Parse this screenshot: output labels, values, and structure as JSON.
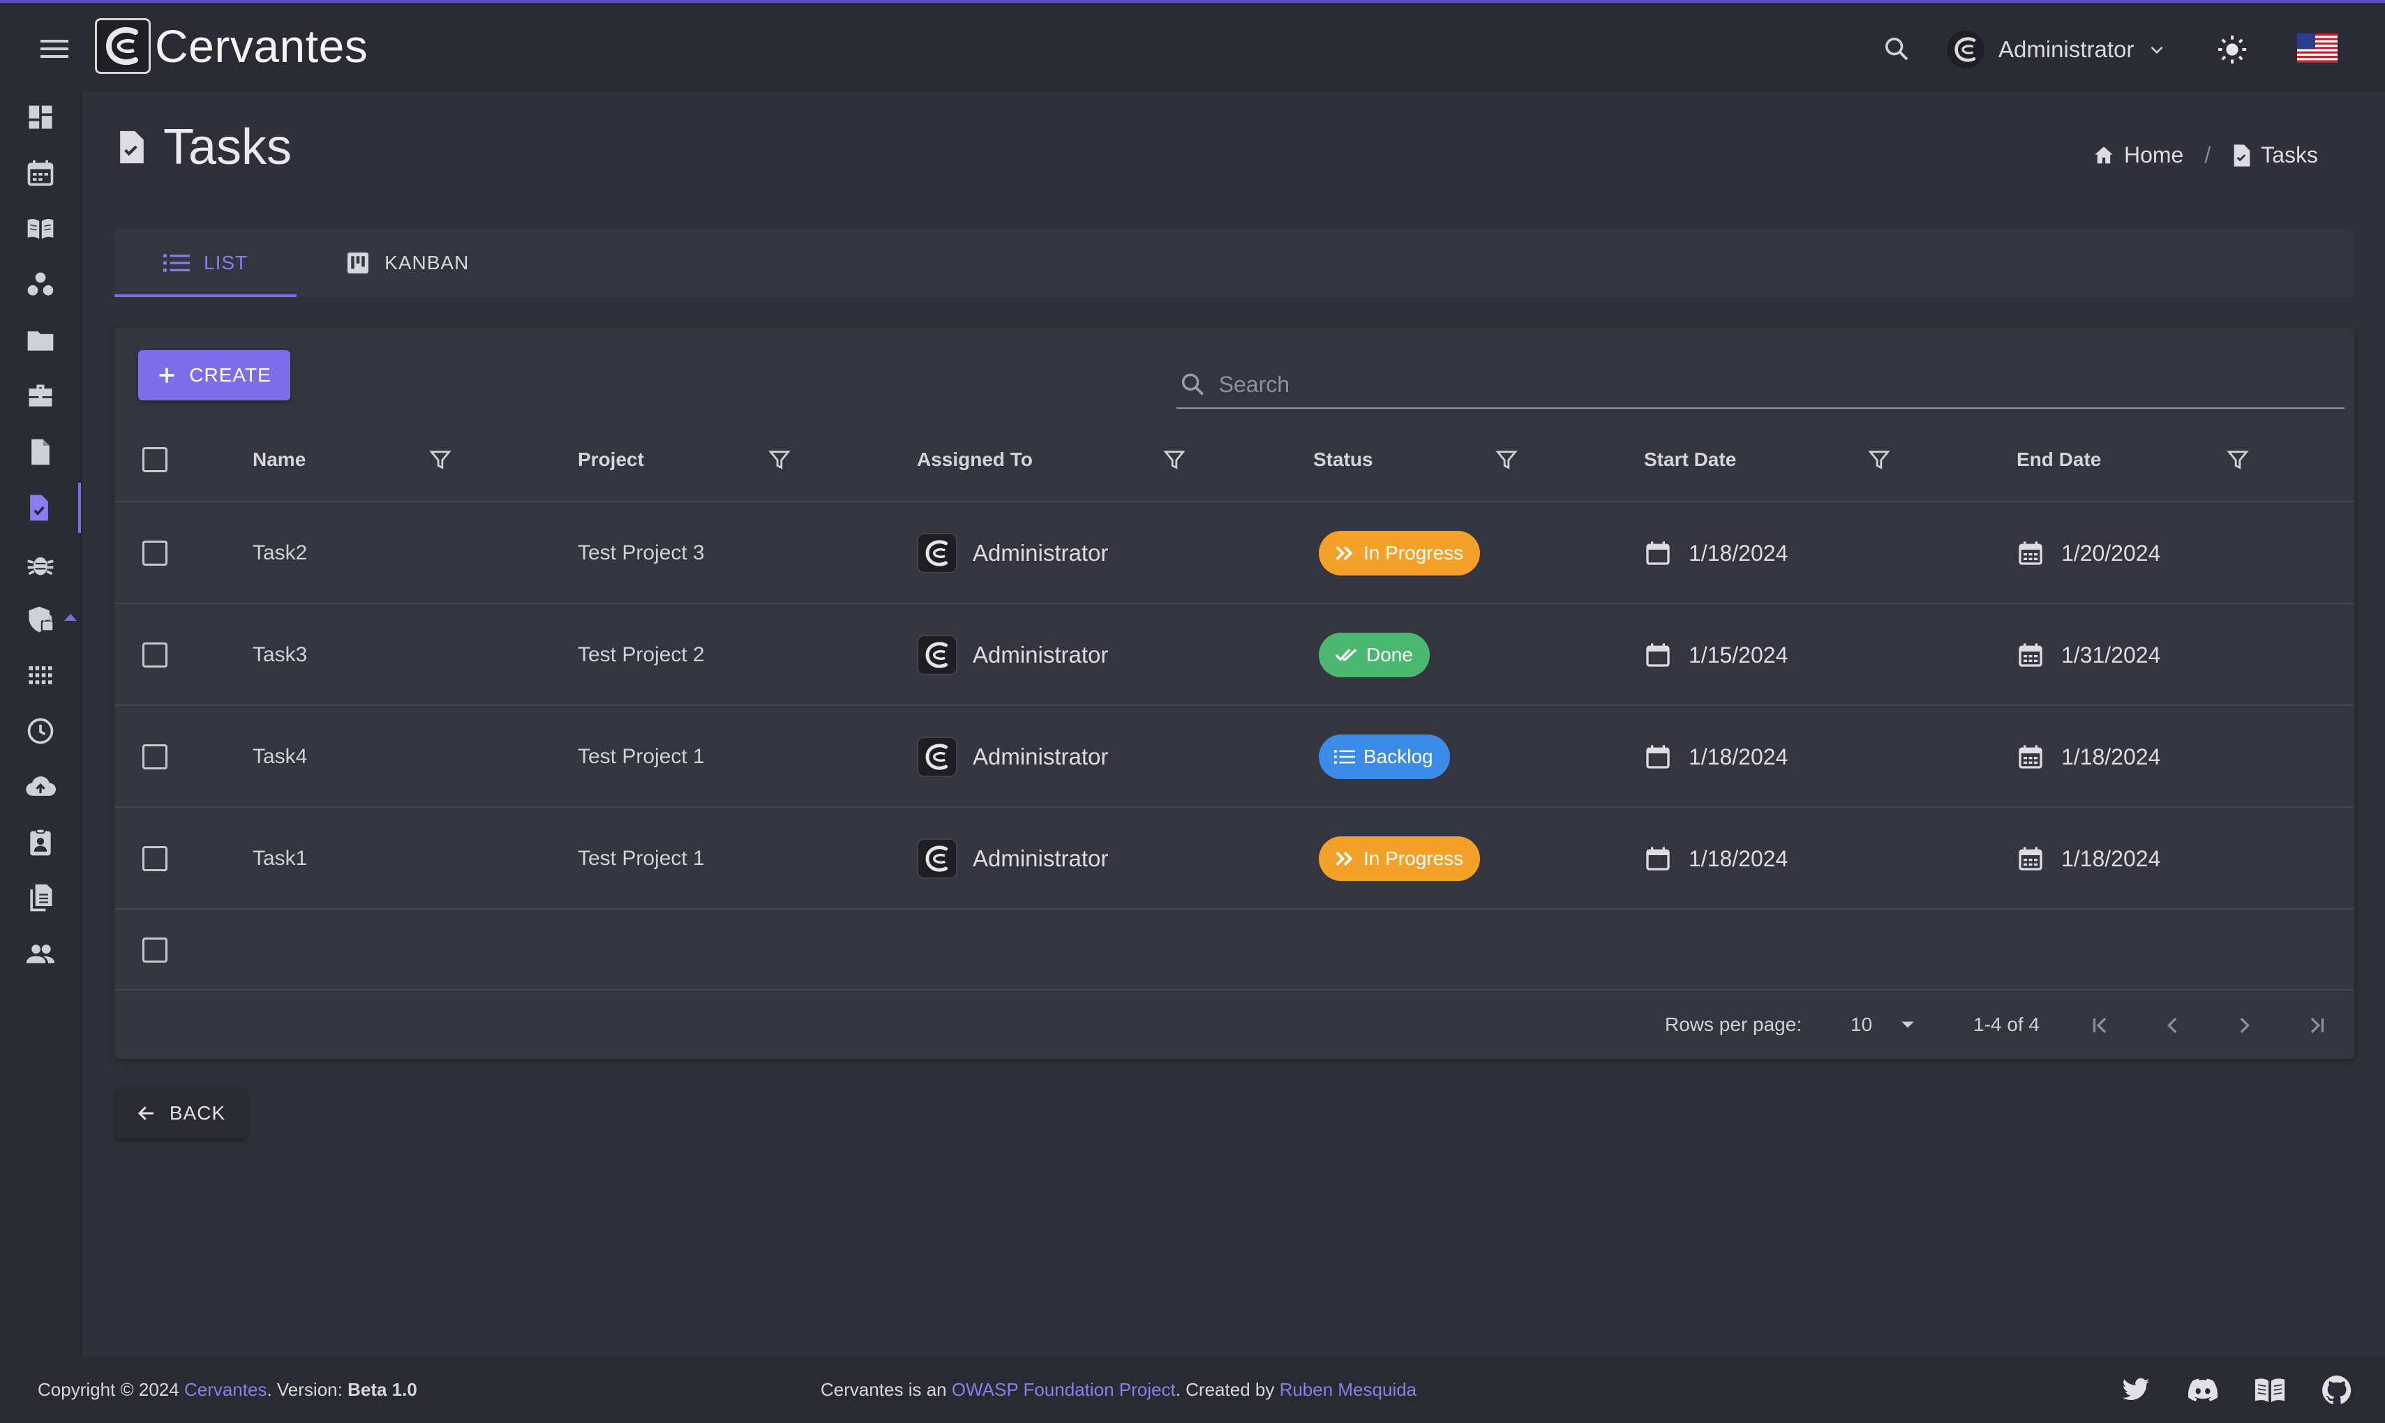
{
  "app": {
    "name": "Cervantes"
  },
  "header": {
    "user": "Administrator"
  },
  "page": {
    "title": "Tasks"
  },
  "breadcrumb": {
    "home": "Home",
    "current": "Tasks"
  },
  "tabs": {
    "list": "LIST",
    "kanban": "KANBAN"
  },
  "toolbar": {
    "create": "CREATE",
    "search_placeholder": "Search"
  },
  "table": {
    "columns": {
      "name": "Name",
      "project": "Project",
      "assigned": "Assigned To",
      "status": "Status",
      "start": "Start Date",
      "end": "End Date"
    },
    "rows": [
      {
        "name": "Task2",
        "project": "Test Project 3",
        "assigned": "Administrator",
        "status": "In Progress",
        "start": "1/18/2024",
        "end": "1/20/2024"
      },
      {
        "name": "Task3",
        "project": "Test Project 2",
        "assigned": "Administrator",
        "status": "Done",
        "start": "1/15/2024",
        "end": "1/31/2024"
      },
      {
        "name": "Task4",
        "project": "Test Project 1",
        "assigned": "Administrator",
        "status": "Backlog",
        "start": "1/18/2024",
        "end": "1/18/2024"
      },
      {
        "name": "Task1",
        "project": "Test Project 1",
        "assigned": "Administrator",
        "status": "In Progress",
        "start": "1/18/2024",
        "end": "1/18/2024"
      }
    ]
  },
  "pagination": {
    "rows_per_page_label": "Rows per page:",
    "rows_per_page": "10",
    "range": "1-4 of 4"
  },
  "back": "BACK",
  "footer": {
    "copyright_prefix": "Copyright © 2024 ",
    "brand": "Cervantes",
    "version_label": ". Version: ",
    "version": "Beta 1.0",
    "owasp_prefix": "Cervantes is an ",
    "owasp_link": "OWASP Foundation Project",
    "created_by": ". Created by ",
    "author": "Ruben Mesquida"
  },
  "colors": {
    "accent": "#7b6ee8",
    "in_progress": "#f4a12a",
    "done": "#4bb86f",
    "backlog": "#3d8be8"
  }
}
